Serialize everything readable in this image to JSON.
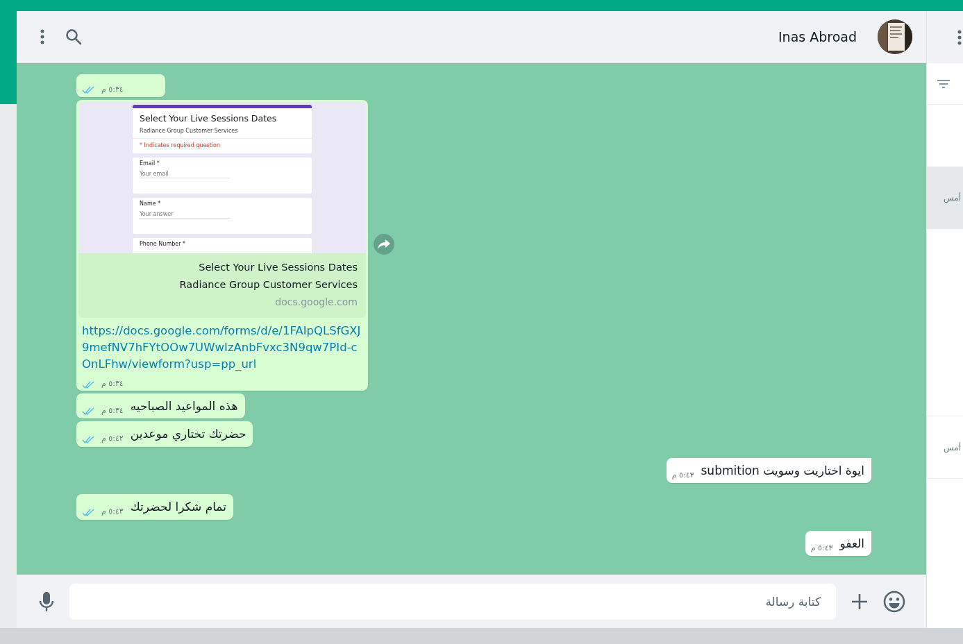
{
  "header": {
    "name": "Inas Abroad"
  },
  "messages": [
    {
      "kind": "stub",
      "outgoing": true,
      "time": "٥:٣٤ م",
      "read": true
    },
    {
      "kind": "link",
      "outgoing": true,
      "preview": {
        "form_title": "Select Your Live Sessions Dates",
        "form_subtitle": "Radiance Group Customer Services",
        "form_required_note": "* Indicates required question",
        "fields": [
          {
            "label": "Email *",
            "hint": "Your email"
          },
          {
            "label": "Name *",
            "hint": "Your answer"
          },
          {
            "label": "Phone Number *"
          }
        ],
        "title": "Select Your Live Sessions Dates",
        "description": "Radiance Group Customer Services",
        "domain": "docs.google.com"
      },
      "url": "https://docs.google.com/forms/d/e/1FAIpQLSfGXJ9mefNV7hFYtOOw7UWwIzAnbFvxc3N9qw7PId-cOnLFhw/viewform?usp=pp_url",
      "time": "٥:٣٤ م",
      "read": true
    },
    {
      "kind": "text",
      "outgoing": true,
      "text": "هذه المواعيد الصباحيه",
      "time": "٥:٣٤ م",
      "read": true
    },
    {
      "kind": "text",
      "outgoing": true,
      "text": "حضرتك تختاري موعدين",
      "time": "٥:٤٢ م",
      "read": true
    },
    {
      "kind": "text",
      "outgoing": false,
      "text": "ايوة اختاريت وسويت submition",
      "time": "٥:٤٣ م"
    },
    {
      "kind": "text",
      "outgoing": true,
      "text": "تمام شكرا لحضرتك",
      "time": "٥:٤٣ م",
      "read": true
    },
    {
      "kind": "text",
      "outgoing": false,
      "text": "العفو",
      "time": "٥:٤٣ م"
    }
  ],
  "composer": {
    "placeholder": "كتابة رسالة"
  },
  "chat_list": [
    {
      "date": "أمس",
      "selected": true
    },
    {
      "date": "أمس",
      "selected": false
    }
  ]
}
